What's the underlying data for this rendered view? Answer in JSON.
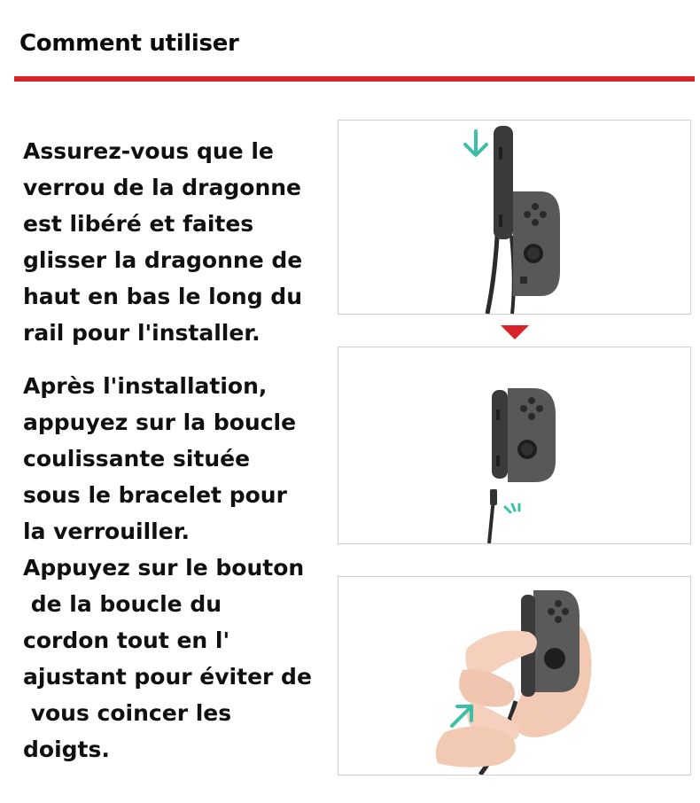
{
  "header": {
    "title": "Comment utiliser",
    "accent_color": "#d9222a"
  },
  "steps": [
    {
      "lines": [
        "Assurez-vous que le",
        "verrou de la dragonne",
        "est libéré et faites",
        "glisser la dragonne de",
        "haut en bas le long du",
        "rail pour l'installer."
      ],
      "illustration_icon": "down-arrow-icon"
    },
    {
      "lines": [
        "Après l'installation,",
        "appuyez sur la boucle",
        "coulissante située",
        "sous le bracelet pour",
        "la verrouiller."
      ],
      "illustration_icon": "press-indicator-icon"
    },
    {
      "lines": [
        "Appuyez sur le bouton",
        " de la boucle du",
        "cordon tout en l'",
        "ajustant pour éviter de",
        " vous coincer les",
        "doigts."
      ],
      "illustration_icon": "up-right-arrow-icon"
    }
  ],
  "colors": {
    "arrow_teal": "#3bbfa6",
    "controller_gray": "#4a4a4a",
    "controller_dark": "#2b2b2b",
    "marker_red": "#d9222a"
  }
}
